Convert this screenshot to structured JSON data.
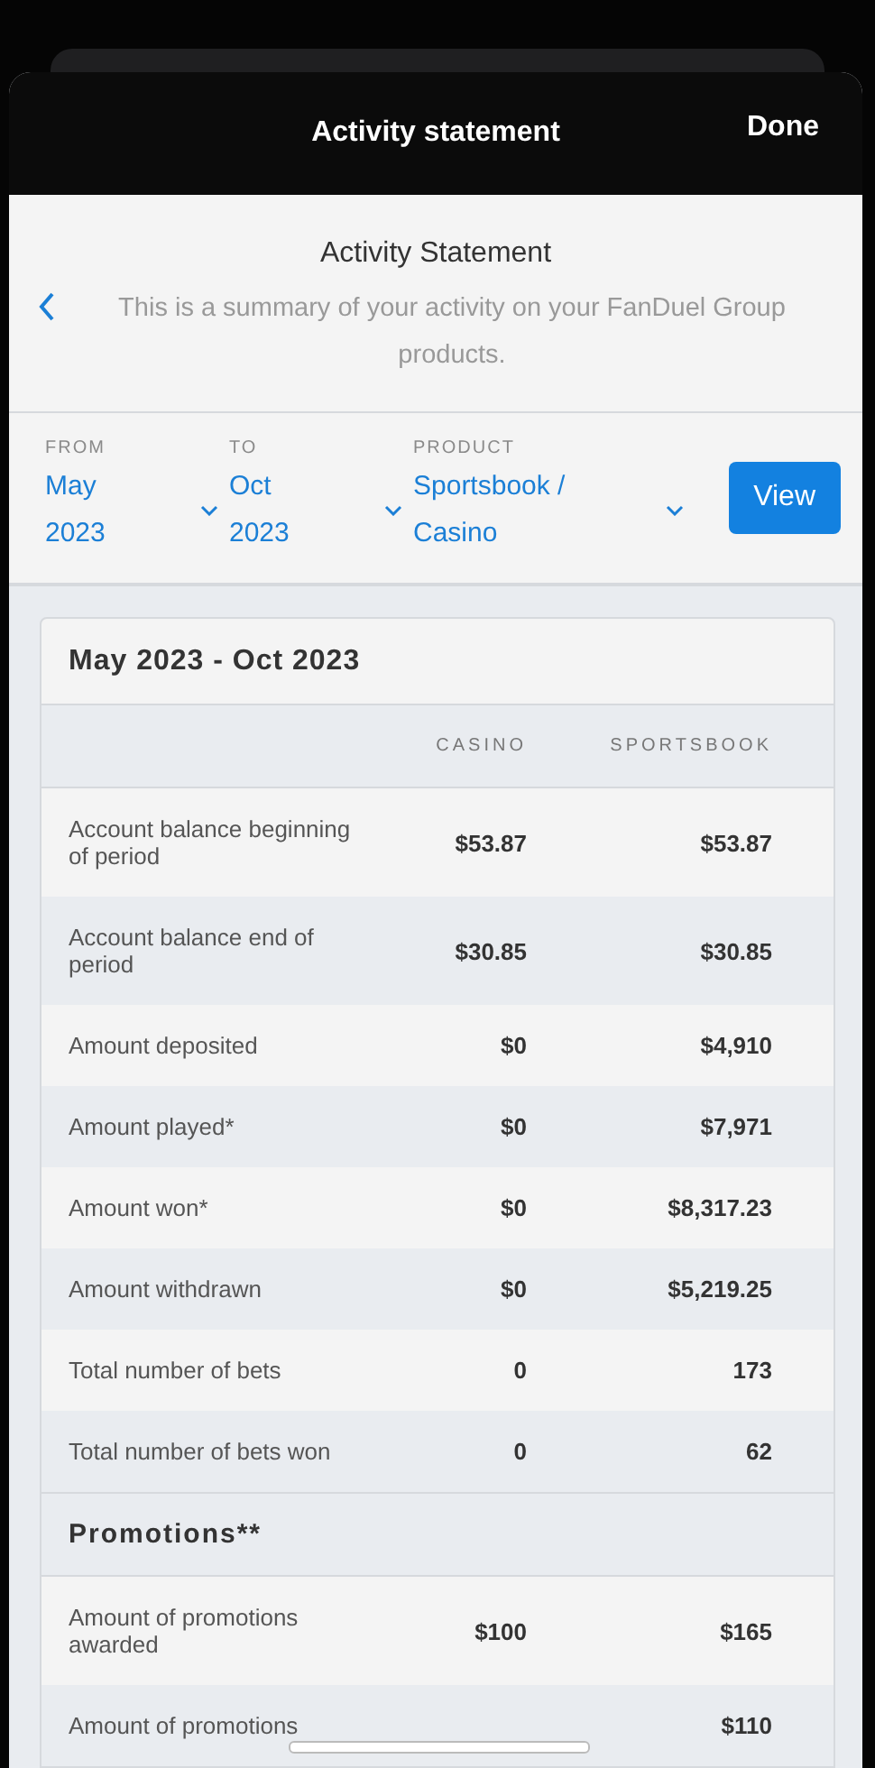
{
  "header": {
    "title": "Activity statement",
    "done": "Done"
  },
  "intro": {
    "title": "Activity Statement",
    "text": "This is a summary of your activity on your FanDuel Group products."
  },
  "filters": [
    {
      "label": "FROM",
      "value": "May 2023"
    },
    {
      "label": "TO",
      "value": "Oct 2023"
    },
    {
      "label": "PRODUCT",
      "value": "Sportsbook / Casino"
    }
  ],
  "view_button": "View",
  "statement": {
    "period": "May 2023 - Oct 2023",
    "columns": [
      "CASINO",
      "SPORTSBOOK"
    ],
    "rows": [
      {
        "label": "Account balance beginning of period",
        "casino": "$53.87",
        "sportsbook": "$53.87"
      },
      {
        "label": "Account balance end of period",
        "casino": "$30.85",
        "sportsbook": "$30.85"
      },
      {
        "label": "Amount deposited",
        "casino": "$0",
        "sportsbook": "$4,910"
      },
      {
        "label": "Amount played*",
        "casino": "$0",
        "sportsbook": "$7,971"
      },
      {
        "label": "Amount won*",
        "casino": "$0",
        "sportsbook": "$8,317.23"
      },
      {
        "label": "Amount withdrawn",
        "casino": "$0",
        "sportsbook": "$5,219.25"
      },
      {
        "label": "Total number of bets",
        "casino": "0",
        "sportsbook": "173"
      },
      {
        "label": "Total number of bets won",
        "casino": "0",
        "sportsbook": "62"
      }
    ]
  },
  "promotions": {
    "title": "Promotions**",
    "rows": [
      {
        "label": "Amount of promotions awarded",
        "casino": "$100",
        "sportsbook": "$165"
      },
      {
        "label": "Amount of promotions",
        "sportsbook": "$110"
      }
    ]
  }
}
